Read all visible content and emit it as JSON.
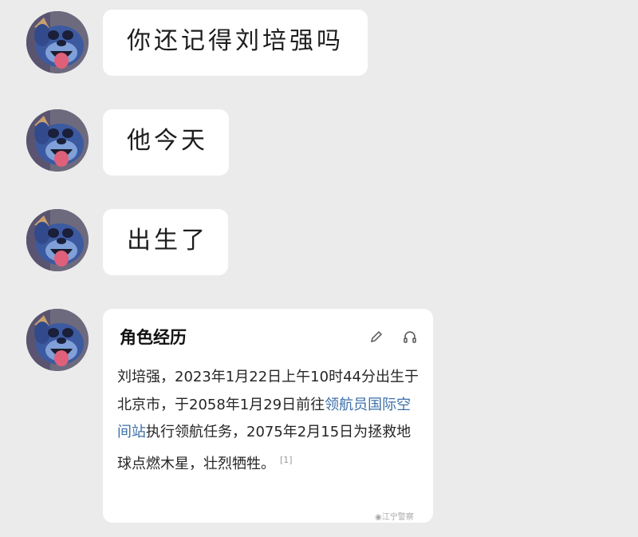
{
  "messages": [
    {
      "text": "你还记得刘培强吗",
      "avatar": "stitch-avatar"
    },
    {
      "text": "他今天",
      "avatar": "stitch-avatar"
    },
    {
      "text": "出生了",
      "avatar": "stitch-avatar"
    }
  ],
  "card": {
    "title": "角色经历",
    "icons": [
      "pencil-icon",
      "headphones-icon"
    ],
    "body_part1": "刘培强，2023年1月22日上午10时44分出生于北京市，于2058年1月29日前往",
    "link_text": "领航员国际空间站",
    "body_part2": "执行领航任务，2075年2月15日为拯救地球点燃木星，壮烈牺牲。",
    "ref": "[1]"
  },
  "watermark": "◉江宁警察",
  "colors": {
    "background": "#ebebeb",
    "bubble": "#ffffff",
    "link": "#3b6fa8"
  }
}
